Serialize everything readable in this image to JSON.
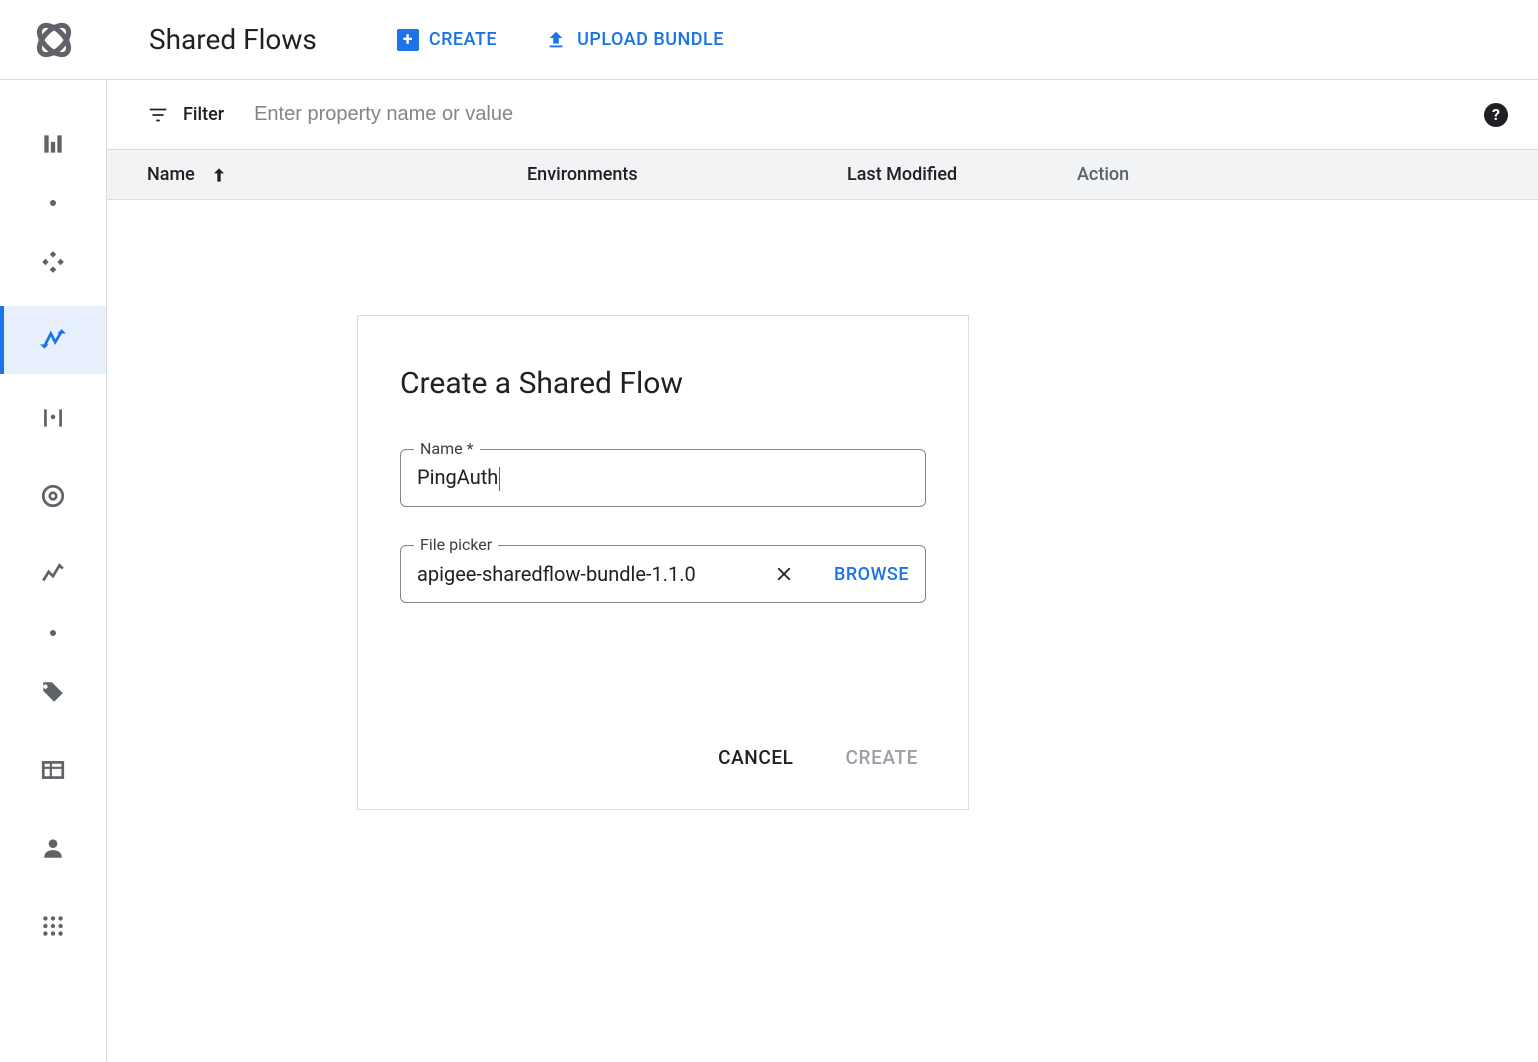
{
  "header": {
    "page_title": "Shared Flows",
    "create_label": "CREATE",
    "upload_label": "UPLOAD BUNDLE"
  },
  "filter": {
    "label": "Filter",
    "placeholder": "Enter property name or value"
  },
  "table": {
    "columns": {
      "name": "Name",
      "environments": "Environments",
      "last_modified": "Last Modified",
      "action": "Action"
    }
  },
  "sidebar": {
    "items": [
      {
        "id": "dashboard-icon"
      },
      {
        "id": "dot-icon-a"
      },
      {
        "id": "develop-icon"
      },
      {
        "id": "shared-flows-icon",
        "active": true
      },
      {
        "id": "add-proxy-icon"
      },
      {
        "id": "debug-icon"
      },
      {
        "id": "analytics-icon"
      },
      {
        "id": "dot-icon-b"
      },
      {
        "id": "tag-icon"
      },
      {
        "id": "table-view-icon"
      },
      {
        "id": "user-icon"
      },
      {
        "id": "apps-icon"
      }
    ]
  },
  "modal": {
    "title": "Create a Shared Flow",
    "name_label": "Name *",
    "name_value": "PingAuth",
    "file_label": "File picker",
    "file_value": "apigee-sharedflow-bundle-1.1.0",
    "browse_label": "BROWSE",
    "cancel_label": "CANCEL",
    "create_label": "CREATE"
  }
}
